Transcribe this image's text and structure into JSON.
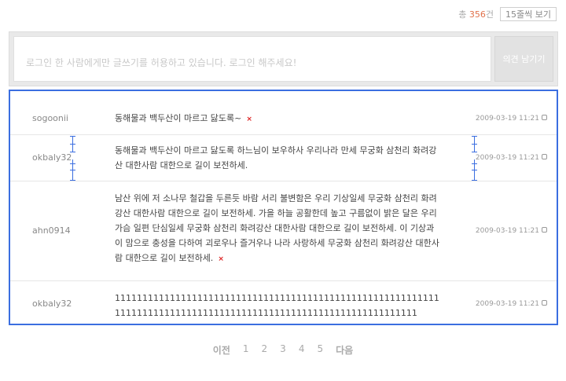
{
  "header": {
    "total_prefix": "총",
    "total_count": "356",
    "total_suffix": "건",
    "per_page": "15줄씩 보기"
  },
  "write": {
    "placeholder": "로그인 한 사람에게만 글쓰기를 허용하고 있습니다. 로그인 해주세요!",
    "submit_label": "의견 남기기"
  },
  "comments": [
    {
      "author": "sogoonii",
      "text": "동해물과 백두산이 마르고 닳도록~",
      "date": "2009-03-19 11:21",
      "deletable": "×"
    },
    {
      "author": "okbaly32",
      "text": "동해물과 백두산이 마르고 닳도록 하느님이 보우하사 우리나라 만세 무궁화 삼천리 화려강산 대한사람 대한으로 길이 보전하세.",
      "date": "2009-03-19 11:21"
    },
    {
      "author": "ahn0914",
      "text": "남산 위에 저 소나무 철갑을 두른듯 바람 서리 불변함은 우리 기상일세 무궁화 삼천리 화려강산 대한사람 대한으로 길이 보전하세. 가을 하늘 공활한데 높고 구름없이 밝은 달은 우리가슴 일편 단심일세 무궁화 삼천리 화려강산 대한사람 대한으로 길이 보전하세. 이 기상과 이 맘으로 충성을 다하여 괴로우나 즐거우나 나라 사랑하세 무궁화 삼천리 화려강산 대한사람 대한으로 길이 보전하세.",
      "date": "2009-03-19 11:21",
      "deletable": "×"
    },
    {
      "author": "okbaly32",
      "text": "111111111111111111111111111111111111111111111111111111111111111111111111111111111111111111111111111111111111111111",
      "date": "2009-03-19 11:21"
    }
  ],
  "pager": {
    "prev": "이전",
    "pages": [
      "1",
      "2",
      "3",
      "4",
      "5"
    ],
    "next": "다음"
  },
  "colors": {
    "accent": "#3b6ee0",
    "count": "#e0704a",
    "delete": "#dd2222"
  }
}
